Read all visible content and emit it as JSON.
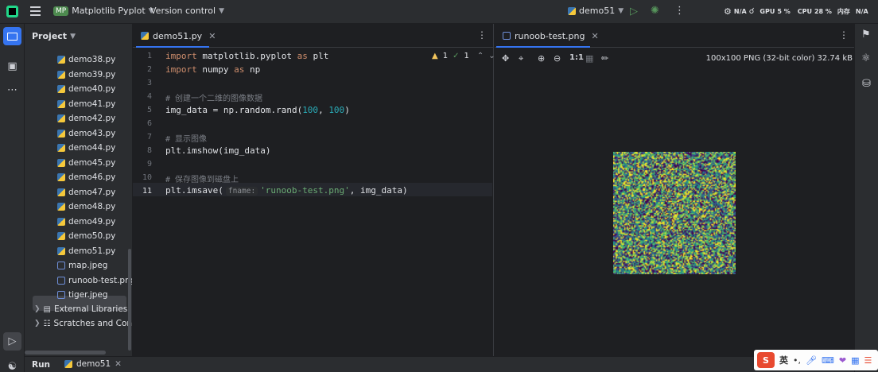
{
  "titlebar": {
    "project_badge": "MP",
    "project_name": "Matplotlib Pyplot",
    "vcs": "Version control",
    "run_config": "demo51",
    "status_na1": "N/A",
    "status_gpu": "GPU",
    "status_gpu_val": "5 %",
    "status_cpu": "CPU",
    "status_cpu_val": "28 %",
    "status_mem": "内存",
    "status_na2": "N/A"
  },
  "project_panel": {
    "header": "Project",
    "files": [
      "demo38.py",
      "demo39.py",
      "demo40.py",
      "demo41.py",
      "demo42.py",
      "demo43.py",
      "demo44.py",
      "demo45.py",
      "demo46.py",
      "demo47.py",
      "demo48.py",
      "demo49.py",
      "demo50.py",
      "demo51.py"
    ],
    "images": [
      "map.jpeg",
      "runoob-test.png",
      "tiger.jpeg"
    ],
    "external_libraries": "External Libraries",
    "scratches": "Scratches and Consoles"
  },
  "editor": {
    "tab_label": "demo51.py",
    "inspections": {
      "warnings": "1",
      "ok": "1"
    },
    "line_numbers": [
      "1",
      "2",
      "3",
      "4",
      "5",
      "6",
      "7",
      "8",
      "9",
      "10",
      "11"
    ],
    "code": {
      "l1_kw1": "import",
      "l1_mod": " matplotlib.pyplot ",
      "l1_kw2": "as",
      "l1_alias": " plt",
      "l2_kw1": "import",
      "l2_mod": " numpy ",
      "l2_kw2": "as",
      "l2_alias": " np",
      "l4_cmt": "# 创建一个二维的图像数据",
      "l5_a": "img_data = np.random.rand(",
      "l5_n1": "100",
      "l5_b": ", ",
      "l5_n2": "100",
      "l5_c": ")",
      "l7_cmt": "# 显示图像",
      "l8": "plt.imshow(img_data)",
      "l10_cmt": "# 保存图像到磁盘上",
      "l11_a": "plt.imsave(",
      "l11_hint": "fname:",
      "l11_str": "'runoob-test.png'",
      "l11_b": ", img_data)"
    }
  },
  "viewer": {
    "tab_label": "runoob-test.png",
    "zoom_label": "1:1",
    "info": "100x100 PNG (32-bit color) 32.74 kB"
  },
  "bottom": {
    "run_label": "Run",
    "run_tab": "demo51"
  },
  "ime": {
    "lang": "英"
  },
  "colors": {
    "accent": "#3574f0",
    "keyword": "#cf8e6d",
    "number": "#2aacb8",
    "string": "#6aab73",
    "comment": "#7a7e85"
  }
}
